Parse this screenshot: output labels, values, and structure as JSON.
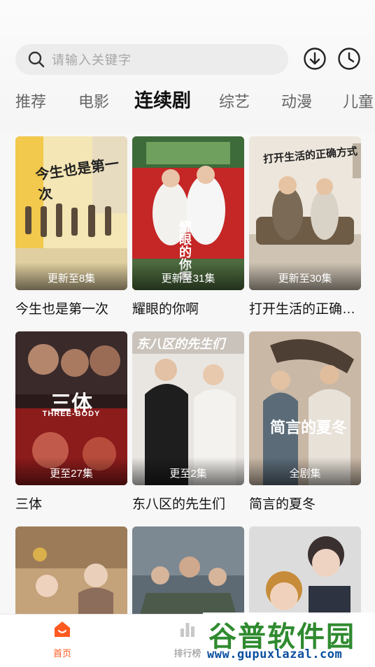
{
  "search": {
    "placeholder": "请输入关键字"
  },
  "header_icons": [
    "download-icon",
    "history-clock-icon"
  ],
  "tabs": [
    {
      "label": "推荐",
      "active": false
    },
    {
      "label": "电影",
      "active": false
    },
    {
      "label": "连续剧",
      "active": true
    },
    {
      "label": "综艺",
      "active": false
    },
    {
      "label": "动漫",
      "active": false
    },
    {
      "label": "儿童",
      "active": false
    }
  ],
  "shows": [
    {
      "title": "今生也是第一次",
      "badge": "更新至8集",
      "poster_text": "今生也是第一次"
    },
    {
      "title": "耀眼的你啊",
      "badge": "更新至31集",
      "poster_text": "耀眼的你啊"
    },
    {
      "title": "打开生活的正确…",
      "badge": "更新至30集",
      "poster_text": "打开生活的正确方式"
    },
    {
      "title": "三体",
      "badge": "更至27集",
      "poster_text": "三体",
      "poster_subtext": "THREE-BODY"
    },
    {
      "title": "东八区的先生们",
      "badge": "更至2集",
      "poster_text": "东八区的先生们"
    },
    {
      "title": "简言的夏冬",
      "badge": "全剧集",
      "poster_text": "简言的夏冬"
    },
    {
      "title": "",
      "badge": ""
    },
    {
      "title": "",
      "badge": ""
    },
    {
      "title": "",
      "badge": ""
    }
  ],
  "colors": {
    "accent": "#ff5a1f",
    "text": "#111111",
    "muted": "#666666"
  },
  "bottom_nav": [
    {
      "label": "首页",
      "icon": "home-icon",
      "active": true
    },
    {
      "label": "排行榜",
      "icon": "ranking-icon",
      "active": false
    }
  ],
  "watermark": {
    "text": "谷普软件园",
    "url": "www.gupuxlazal.com"
  }
}
